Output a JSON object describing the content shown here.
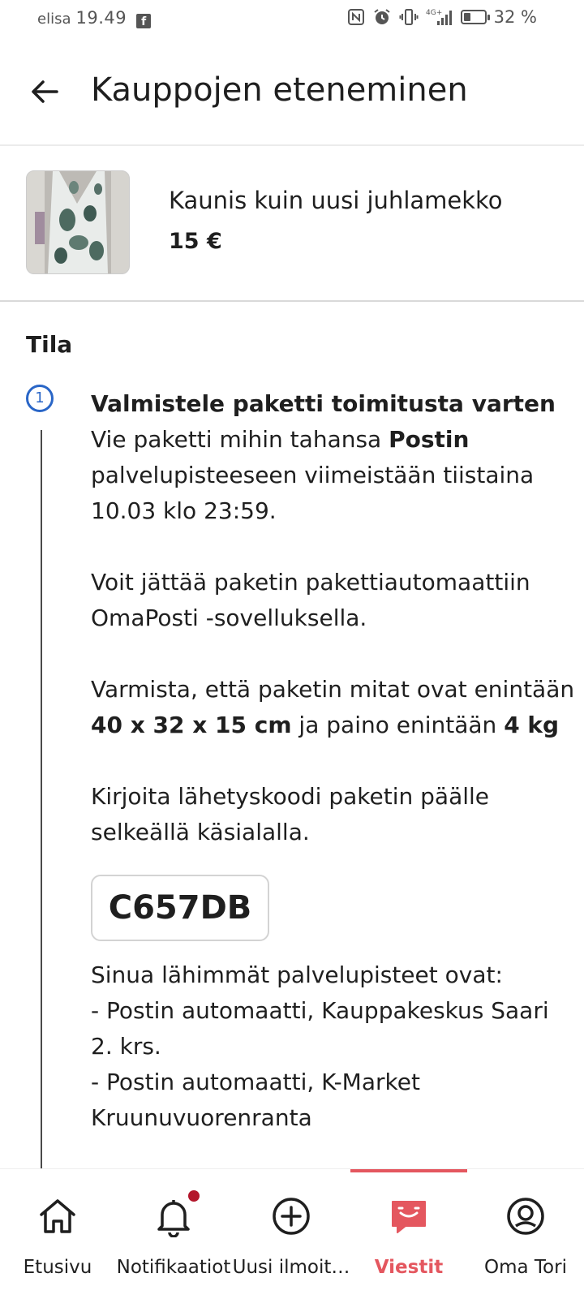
{
  "status_bar": {
    "carrier": "elisa",
    "time": "19.49",
    "battery_percent": "32 %",
    "battery_level": 0.32,
    "network": "4G+",
    "icons": [
      "facebook-icon",
      "nfc-icon",
      "alarm-icon",
      "vibrate-icon",
      "signal-icon",
      "battery-icon"
    ]
  },
  "header": {
    "title": "Kauppojen eteneminen",
    "back_icon": "arrow-left-icon"
  },
  "product": {
    "name": "Kaunis kuin uusi juhlamekko",
    "price": "15 €"
  },
  "status_section": {
    "title": "Tila",
    "step_number": "1",
    "step_title": "Valmistele paketti toimitusta varten",
    "para1_prefix": "Vie paketti mihin tahansa ",
    "para1_bold": "Postin",
    "para1_suffix": " palvelupisteeseen viimeistään tiistaina 10.03 klo 23:59.",
    "para2": "Voit jättää paketin pakettiautomaattiin OmaPosti -sovelluksella.",
    "para3_prefix": "Varmista, että paketin mitat ovat enintään ",
    "para3_bold_dims": "40 x 32 x 15 cm",
    "para3_middle": " ja paino enintään ",
    "para3_bold_weight": "4 kg",
    "para4": "Kirjoita lähetyskoodi paketin päälle selkeällä käsialalla.",
    "shipping_code": "C657DB",
    "nearest_title": "Sinua lähimmät palvelupisteet ovat:",
    "nearest_1": "- Postin automaatti, Kauppakeskus Saari 2. krs.",
    "nearest_2": "- Postin automaatti, K-Market Kruunuvuorenranta"
  },
  "bottom_nav": {
    "items": [
      {
        "label": "Etusivu",
        "icon": "home-icon"
      },
      {
        "label": "Notifikaatiot",
        "icon": "bell-icon"
      },
      {
        "label": "Uusi ilmoit…",
        "icon": "plus-circle-icon"
      },
      {
        "label": "Viestit",
        "icon": "chat-icon",
        "active": true
      },
      {
        "label": "Oma Tori",
        "icon": "profile-icon"
      }
    ]
  },
  "colors": {
    "accent": "#e4575f",
    "step_blue": "#2a66c7",
    "notification_dot": "#b3162b",
    "text": "#1f1f1f"
  }
}
